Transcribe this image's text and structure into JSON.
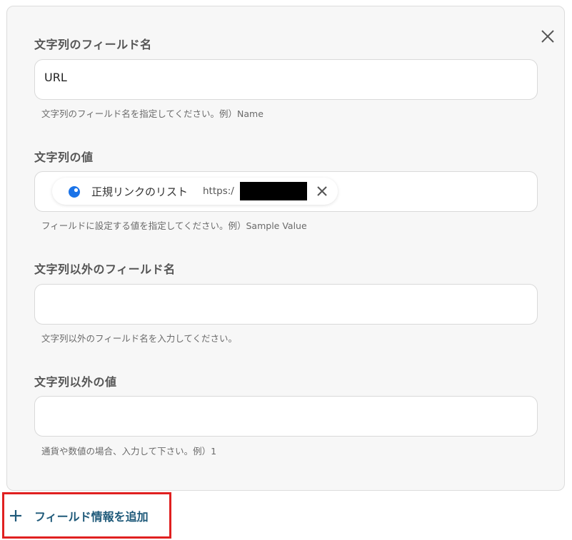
{
  "colors": {
    "panel_bg": "#f7f7f7",
    "accent": "#1f5a7a",
    "chip_icon": "#1a73e8",
    "highlight": "#e02020"
  },
  "form": {
    "string_field_name": {
      "label": "文字列のフィールド名",
      "value": "URL",
      "hint": "文字列のフィールド名を指定してください。例）Name"
    },
    "string_value": {
      "label": "文字列の値",
      "chip": {
        "icon": "blue-circle-icon",
        "name": "正規リンクのリスト",
        "url_prefix": "https:/"
      },
      "hint": "フィールドに設定する値を指定してください。例）Sample Value"
    },
    "other_field_name": {
      "label": "文字列以外のフィールド名",
      "value": "",
      "hint": "文字列以外のフィールド名を入力してください。"
    },
    "other_value": {
      "label": "文字列以外の値",
      "value": "",
      "hint": "通貨や数値の場合、入力して下さい。例）1"
    }
  },
  "actions": {
    "add_field_label": "フィールド情報を追加"
  },
  "icons": {
    "close": "close-icon",
    "chip_remove": "close-icon",
    "add": "plus-icon"
  }
}
